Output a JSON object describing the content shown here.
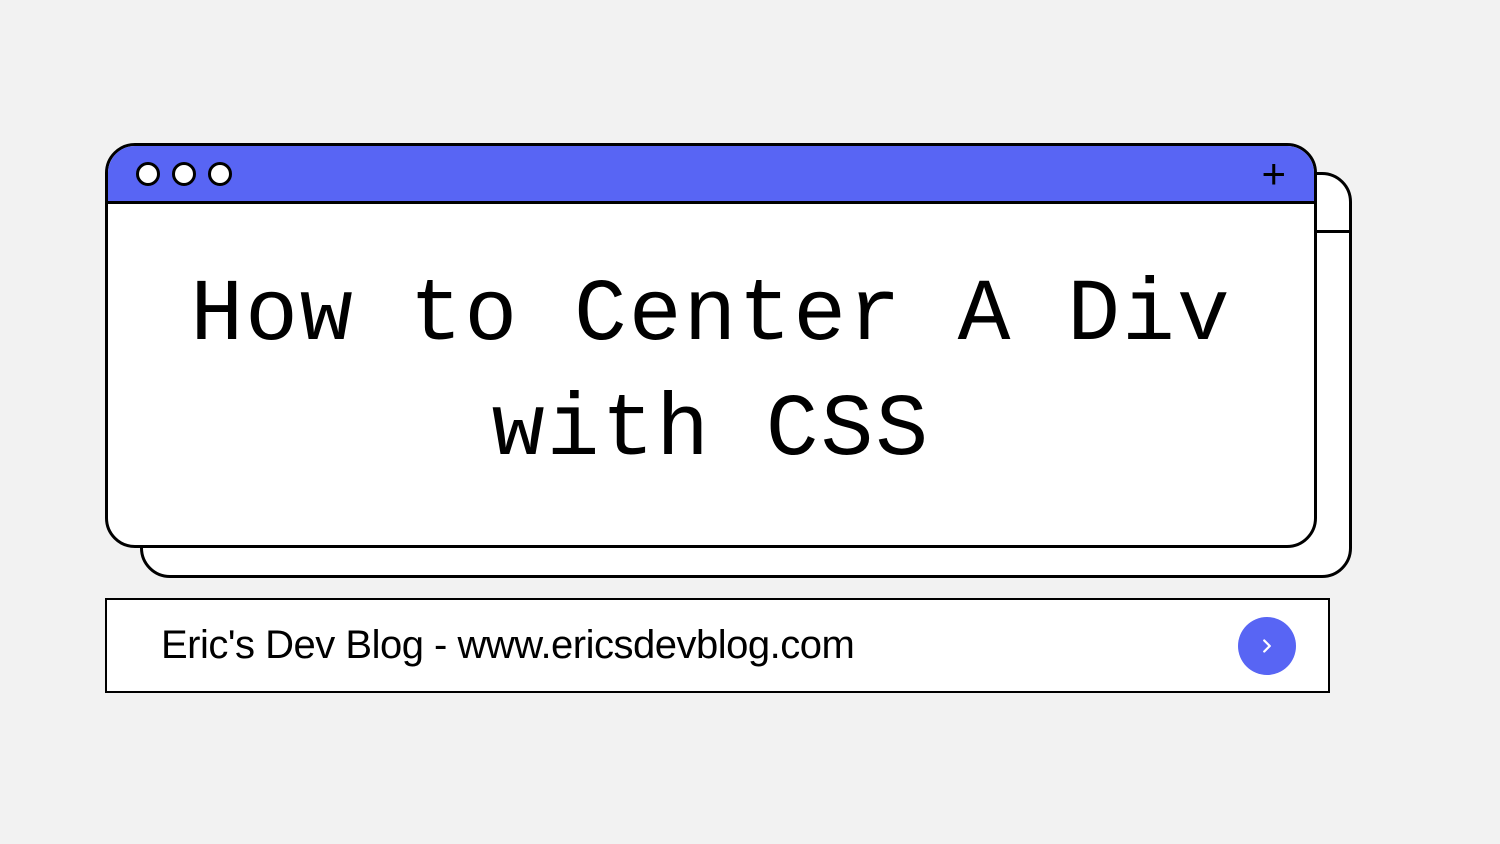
{
  "title": "How to Center A Div with CSS",
  "blog_text": "Eric's Dev Blog - www.ericsdevblog.com",
  "colors": {
    "accent": "#5865f4",
    "background": "#f2f2f2"
  }
}
